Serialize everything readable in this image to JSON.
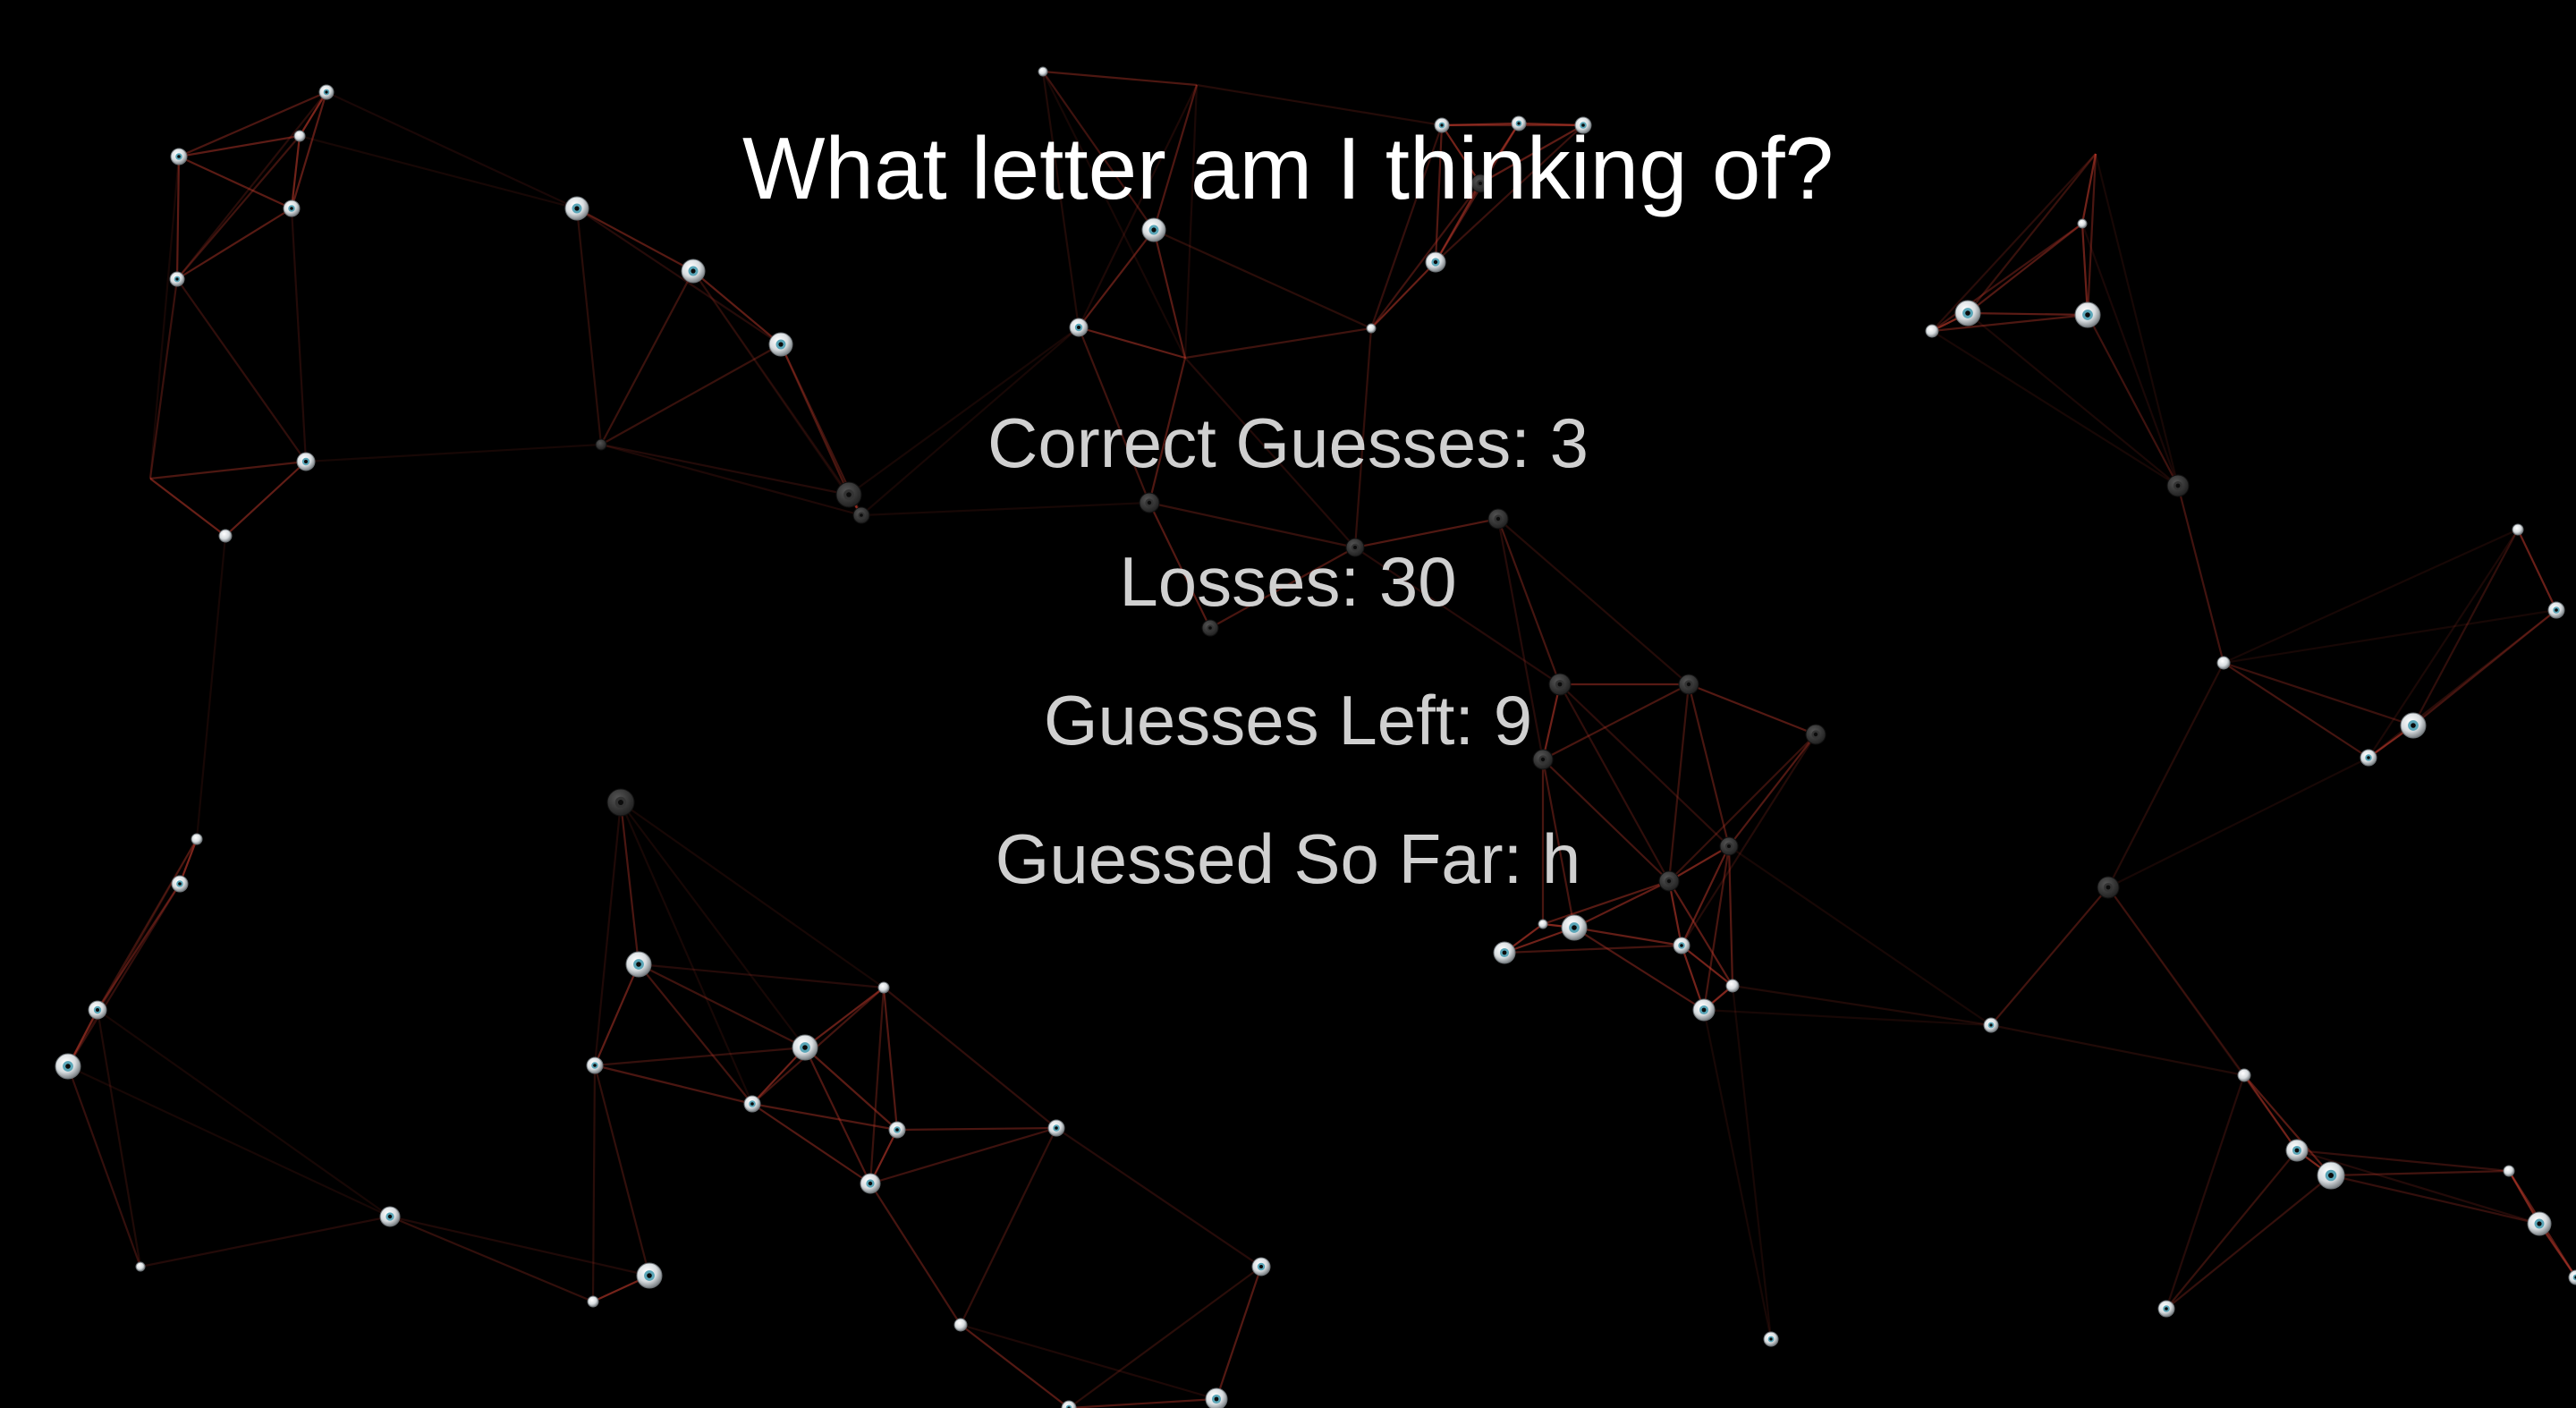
{
  "game": {
    "title": "What letter am I thinking of?",
    "correct_guesses": "Correct Guesses: 3",
    "losses": "Losses: 30",
    "guesses_left": "Guesses Left: 9",
    "guessed_so_far": "Guessed So Far: h"
  },
  "colors": {
    "background": "#000000",
    "title_text": "#ffffff",
    "stat_text": "#d0d0d0",
    "network_line": "#c0392b",
    "eye_node": "#e8ecef",
    "eye_iris": "#5aa6b8"
  },
  "decoration": {
    "theme": "network of eyeball nodes connected by red lines"
  }
}
